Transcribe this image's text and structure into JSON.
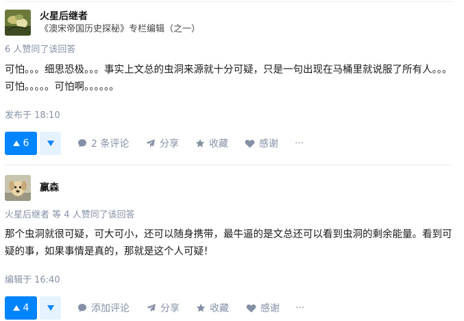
{
  "answers": [
    {
      "author": "火星后继者",
      "bio": "《澳宋帝国历史探秘》专栏编辑（之一）",
      "voters": "6 人赞同了该回答",
      "content": "可怕。。。细思恐极。。。事实上文总的虫洞来源就十分可疑，只是一句出现在马桶里就说服了所有人。。。可怕。。。。。可怕啊。。。。。。",
      "time": "发布于 18:10",
      "upvotes": "6",
      "comments": "2 条评论",
      "share": "分享",
      "collect": "收藏",
      "thanks": "感谢",
      "more": "···"
    },
    {
      "author": "赢森",
      "voters": "火星后继者 等 4 人赞同了该回答",
      "content": "那个虫洞就很可疑，可大可小，还可以随身携带，最牛逼的是文总还可以看到虫洞的剩余能量。看到可疑的事，如果事情是真的，那就是这个人可疑！",
      "time": "编辑于 16:40",
      "upvotes": "4",
      "comments": "添加评论",
      "share": "分享",
      "collect": "收藏",
      "thanks": "感谢",
      "more": "···"
    }
  ],
  "colors": {
    "accent": "#0084ff",
    "meta": "#8590a6",
    "vote_down_bg": "#e5f2ff"
  },
  "icons": [
    "up-triangle-icon",
    "down-triangle-icon",
    "comment-icon",
    "share-icon",
    "star-icon",
    "heart-icon",
    "more-icon"
  ]
}
